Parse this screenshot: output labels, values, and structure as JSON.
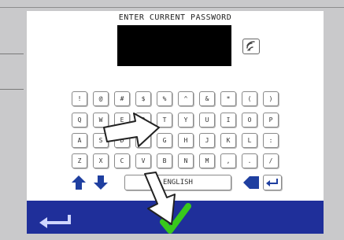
{
  "prompt": {
    "title": "ENTER CURRENT PASSWORD"
  },
  "keyboard": {
    "row1": [
      "!",
      "@",
      "#",
      "$",
      "%",
      "^",
      "&",
      "*",
      "(",
      ")"
    ],
    "row2": [
      "Q",
      "W",
      "E",
      "R",
      "T",
      "Y",
      "U",
      "I",
      "O",
      "P"
    ],
    "row3": [
      "A",
      "S",
      "D",
      "F",
      "G",
      "H",
      "J",
      "K",
      "L",
      ":"
    ],
    "row4": [
      "Z",
      "X",
      "C",
      "V",
      "B",
      "N",
      "M",
      ",",
      ".",
      "/"
    ],
    "language_label": "ENGLISH"
  },
  "icons": {
    "wifi": "wifi-icon",
    "shift_up": "arrow-up-icon",
    "shift_down": "arrow-down-icon",
    "backspace": "backspace-icon",
    "enter": "enter-icon",
    "back": "back-arrow-icon",
    "confirm": "checkmark-icon",
    "pointer": "pointer-arrow-icon"
  },
  "colors": {
    "bottom_bar": "#1f2f9a",
    "confirm_check": "#38c81c",
    "field_background": "#000000"
  }
}
